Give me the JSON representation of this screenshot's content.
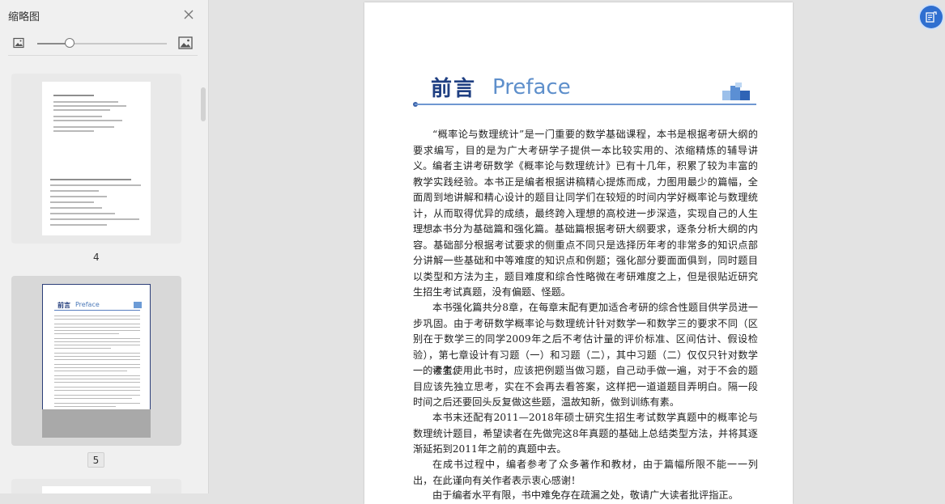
{
  "sidebar": {
    "title": "缩略图",
    "close_icon": "close-icon",
    "zoom": {
      "small_icon": "image-small-icon",
      "large_icon": "image-large-icon",
      "level": 0.25
    },
    "thumbnails": [
      {
        "page_number": "4",
        "selected": false
      },
      {
        "page_number": "5",
        "selected": true,
        "heading_cn": "前言",
        "heading_en": "Preface"
      }
    ]
  },
  "document": {
    "title_cn": "前言",
    "title_en": "Preface",
    "paragraphs": [
      "“概率论与数理统计”是一门重要的数学基础课程，本书是根据考研大纲的要求编写，目的是为广大考研学子提供一本比较实用的、浓缩精炼的辅导讲义。",
      "编者主讲考研数学《概率论与数理统计》已有十几年，积累了较为丰富的教学实践经验。本书正是编者根据讲稿精心提炼而成，力图用最少的篇幅，全面周到地讲解和精心设计的题目让同学们在较短的时间内学好概率论与数理统计，从而取得优异的成绩，最终跨入理想的高校进一步深造，实现自己的人生理想。",
      "本书分为基础篇和强化篇。基础篇根据考研大纲要求，逐条分析大纲的内容。基础部分根据考试要求的侧重点不同只是选择历年考的非常多的知识点部分讲解一些基础和中等难度的知识点和例题；强化部分要面面俱到，同时题目以类型和方法为主，题目难度和综合性略微在考研难度之上，但是很贴近研究生招生考试真题，没有偏题、怪题。",
      "本书强化篇共分8章，在每章末配有更加适合考研的综合性题目供学员进一步巩固。由于考研数学概率论与数理统计针对数学一和数学三的要求不同（区别在于数学三的同学2009年之后不考估计量的评价标准、区间估计、假设检验），第七章设计有习题（一）和习题（二），其中习题（二）仅仅只针对数学一的考生。",
      "读者使用此书时，应该把例题当做习题，自己动手做一遍，对于不会的题目应该先独立思考，实在不会再去看答案，这样把一道道题目弄明白。隔一段时间之后还要回头反复做这些题，温故知新，做到训练有素。",
      "本书末还配有2011—2018年硕士研究生招生考试数学真题中的概率论与数理统计题目，希望读者在先做完这8年真题的基础上总结类型方法，并将其逐渐延拓到2011年之前的真题中去。",
      "在成书过程中，编者参考了众多著作和教材，由于篇幅所限不能一一列出，在此谨向有关作者表示衷心感谢！",
      "由于编者水平有限，书中难免存在疏漏之处，敬请广大读者批评指正。"
    ]
  },
  "float_button": {
    "icon": "ocr-scan-icon"
  },
  "colors": {
    "accent": "#2f6fd0",
    "title_dark": "#1f3f82",
    "title_light": "#5e8fcb"
  }
}
